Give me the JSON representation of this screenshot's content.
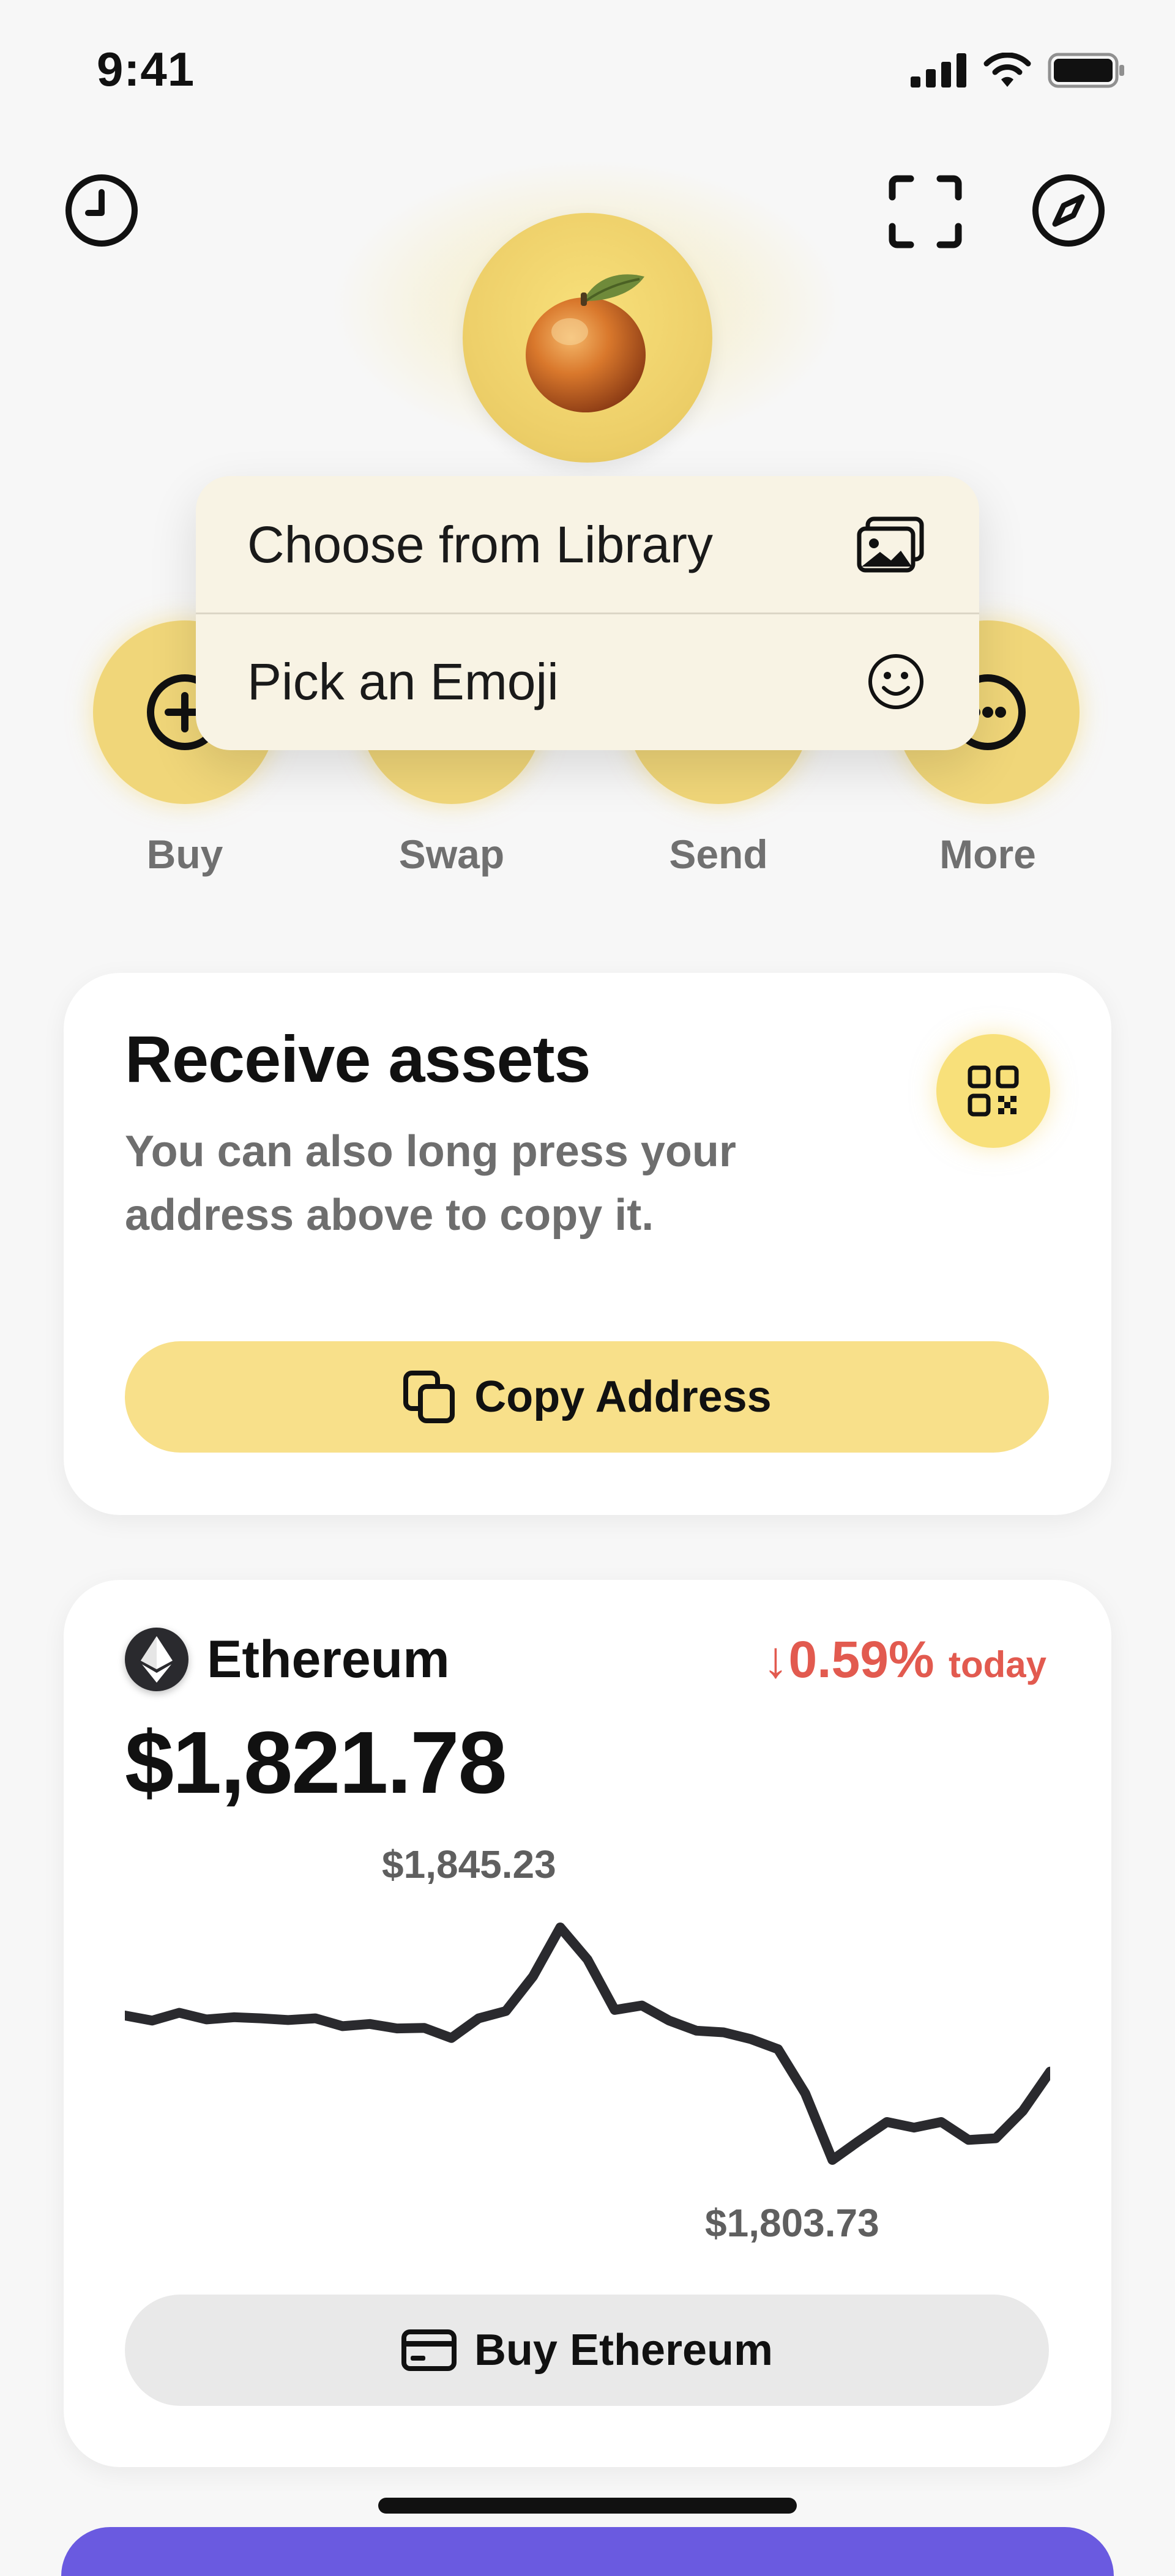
{
  "status_bar": {
    "time": "9:41"
  },
  "icons": {
    "history": "clock-icon",
    "scan": "scan-icon",
    "explore": "compass-icon",
    "avatar": "orange-emoji",
    "library": "photos-icon",
    "emoji": "smiley-icon",
    "qr": "qr-code-icon",
    "copy": "copy-icon",
    "card": "credit-card-icon"
  },
  "context_menu": {
    "items": [
      {
        "label": "Choose from Library"
      },
      {
        "label": "Pick an Emoji"
      }
    ]
  },
  "actions": [
    {
      "label": "Buy"
    },
    {
      "label": "Swap"
    },
    {
      "label": "Send"
    },
    {
      "label": "More"
    }
  ],
  "receive_card": {
    "title": "Receive assets",
    "subtitle": "You can also long press your address above to copy it.",
    "copy_button": "Copy Address"
  },
  "asset_card": {
    "name": "Ethereum",
    "price": "$1,821.78",
    "change_arrow": "↓",
    "change": "0.59%",
    "change_period": "today",
    "high_label": "$1,845.23",
    "low_label": "$1,803.73",
    "buy_button": "Buy Ethereum"
  },
  "colors": {
    "accent_yellow": "#f8e08a",
    "negative_red": "#e25a4f",
    "background": "#f7f7f7"
  },
  "chart_data": {
    "type": "line",
    "series": [
      {
        "values": [
          1829.5,
          1828.6,
          1830.0,
          1828.8,
          1829.2,
          1829.0,
          1828.7,
          1829.0,
          1827.6,
          1828.0,
          1827.2,
          1827.3,
          1825.5,
          1829.0,
          1830.3,
          1836.5,
          1845.23,
          1839.5,
          1830.5,
          1831.3,
          1828.6,
          1826.8,
          1826.5,
          1825.3,
          1823.5,
          1815.6,
          1803.73,
          1807.2,
          1810.5,
          1809.5,
          1810.5,
          1807.3,
          1807.6,
          1812.5,
          1819.5
        ]
      }
    ],
    "annotations": [
      "$1,845.23",
      "$1,803.73"
    ]
  }
}
